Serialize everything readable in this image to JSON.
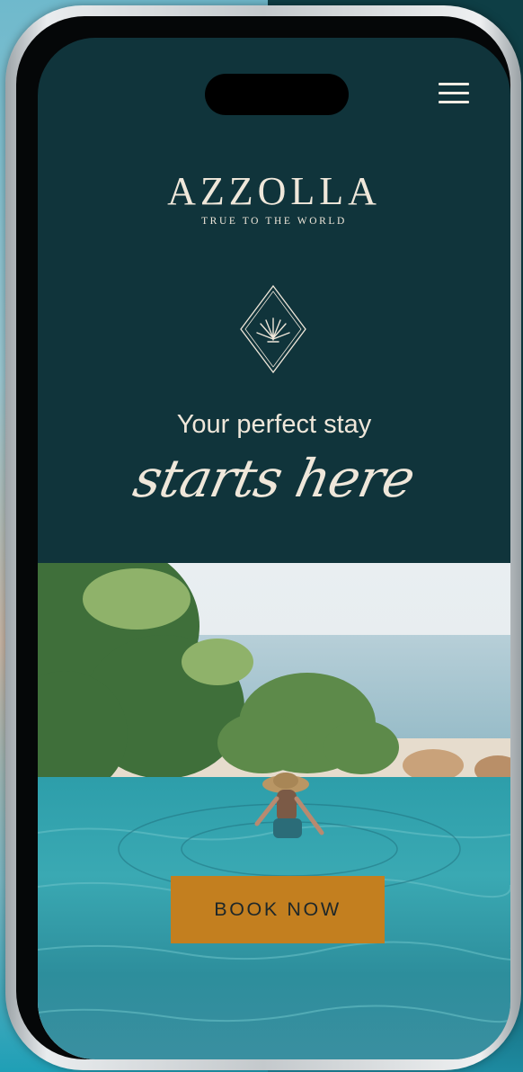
{
  "brand": {
    "name": "AZZOLLA",
    "tagline": "TRUE TO THE WORLD"
  },
  "hero": {
    "headline": "Your perfect stay",
    "script_line": "starts here",
    "cta_label": "BOOK NOW"
  },
  "colors": {
    "background": "#10343b",
    "text": "#efe7da",
    "cta": "#c37f1f",
    "cta_text": "#1e2729"
  },
  "icons": {
    "menu": "hamburger-menu-icon",
    "emblem": "leaf-diamond-emblem"
  }
}
